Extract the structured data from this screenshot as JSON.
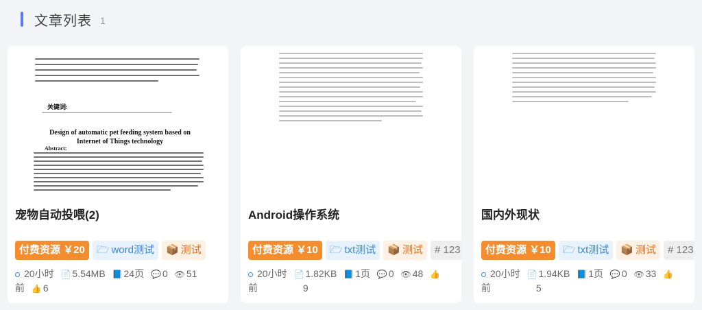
{
  "header": {
    "title": "文章列表",
    "count": "1"
  },
  "cards": [
    {
      "thumb_title": "Design of automatic pet feeding system based on Internet of Things technology",
      "thumb_keywords": "关键词:",
      "thumb_abstract": "Abstract:",
      "title": "宠物自动投喂(2)",
      "price": "付费资源 ￥20",
      "format": "word测试",
      "test": "测试",
      "meta_time_a": "20小时",
      "meta_time_b": "前",
      "size": "5.54MB",
      "pages": "24页",
      "comments": "0",
      "views": "51",
      "likes": "6"
    },
    {
      "title": "Android操作系统",
      "price": "付费资源 ￥10",
      "format": "txt测试",
      "test": "测试",
      "num": "# 123",
      "meta_time_a": "20小时",
      "meta_time_b": "前",
      "size": "1.82KB",
      "pages": "1页",
      "comments": "0",
      "views": "48",
      "likes": "9"
    },
    {
      "title": "国内外现状",
      "price": "付费资源 ￥10",
      "format": "txt测试",
      "test": "测试",
      "num": "# 123",
      "meta_time_a": "20小时",
      "meta_time_b": "前",
      "size": "1.94KB",
      "pages": "1页",
      "comments": "0",
      "views": "33",
      "likes": "5"
    }
  ],
  "icons": [
    "folder-icon",
    "box-icon",
    "file-icon",
    "pages-icon",
    "comment-icon",
    "eye-icon",
    "thumb-up-icon",
    "clock-dot-icon"
  ]
}
